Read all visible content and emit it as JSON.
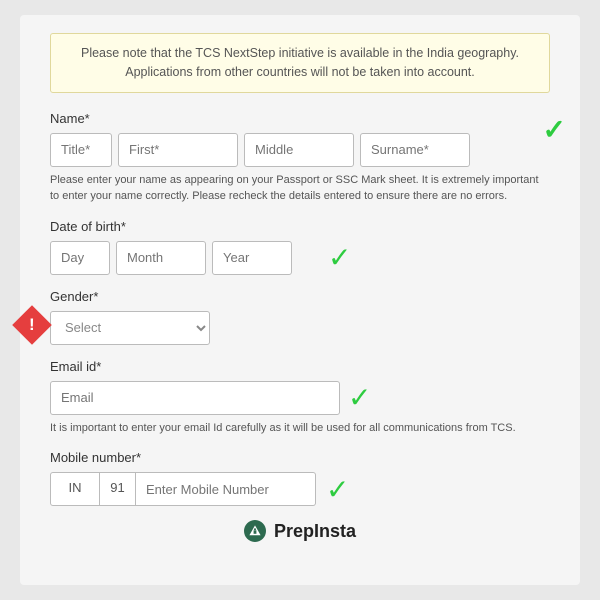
{
  "notice": {
    "line1": "Please note that the TCS NextStep initiative is available in the India geography.",
    "line2": "Applications from other countries will not be taken into account."
  },
  "name_field": {
    "label": "Name*",
    "title_placeholder": "Title*",
    "first_placeholder": "First*",
    "middle_placeholder": "Middle",
    "surname_placeholder": "Surname*",
    "helper": "Please enter your name as appearing on your Passport or SSC Mark sheet. It is extremely important to enter your name correctly. Please recheck the details entered to ensure there are no errors."
  },
  "dob_field": {
    "label": "Date of birth*",
    "day_placeholder": "Day",
    "month_placeholder": "Month",
    "year_placeholder": "Year"
  },
  "gender_field": {
    "label": "Gender*",
    "select_placeholder": "Select"
  },
  "email_field": {
    "label": "Email id*",
    "placeholder": "Email",
    "helper": "It is important to enter your email Id carefully as it will be used for all communications from TCS."
  },
  "mobile_field": {
    "label": "Mobile number*",
    "country": "IN",
    "code": "91",
    "placeholder": "Enter Mobile Number"
  },
  "footer": {
    "brand": "PrepInsta"
  }
}
